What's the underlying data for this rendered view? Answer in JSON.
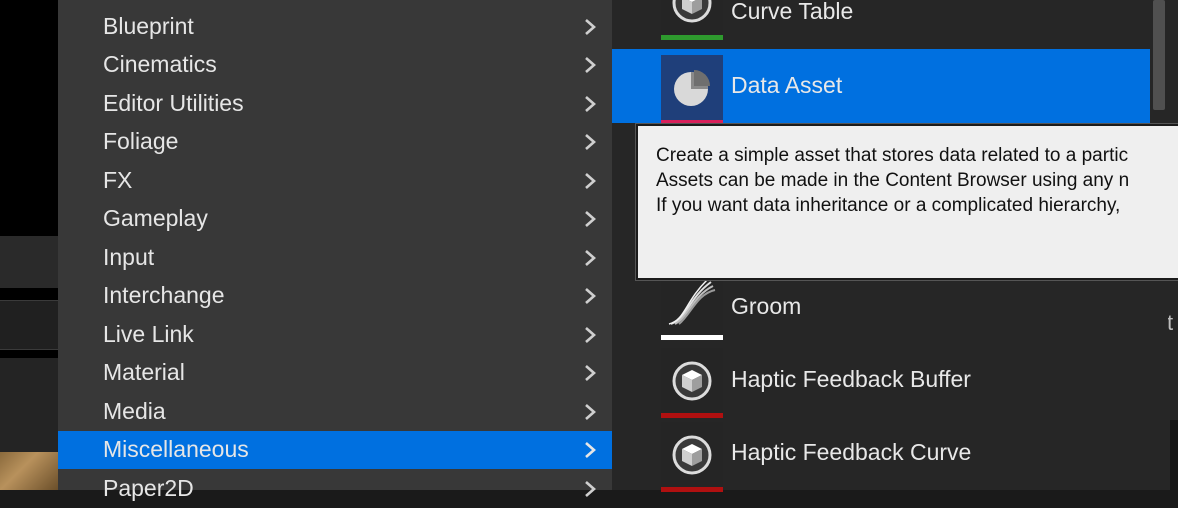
{
  "category_menu": {
    "items": [
      {
        "label": "Blueprint",
        "selected": false
      },
      {
        "label": "Cinematics",
        "selected": false
      },
      {
        "label": "Editor Utilities",
        "selected": false
      },
      {
        "label": "Foliage",
        "selected": false
      },
      {
        "label": "FX",
        "selected": false
      },
      {
        "label": "Gameplay",
        "selected": false
      },
      {
        "label": "Input",
        "selected": false
      },
      {
        "label": "Interchange",
        "selected": false
      },
      {
        "label": "Live Link",
        "selected": false
      },
      {
        "label": "Material",
        "selected": false
      },
      {
        "label": "Media",
        "selected": false
      },
      {
        "label": "Miscellaneous",
        "selected": true
      },
      {
        "label": "Paper2D",
        "selected": false
      }
    ],
    "arrow_icon": "chevron-right-icon"
  },
  "asset_list": {
    "items": [
      {
        "label": "Curve Table",
        "icon": "cube-icon",
        "color_bar": "#2e9a2e",
        "selected": false
      },
      {
        "label": "Data Asset",
        "icon": "pie-chart-icon",
        "color_bar": "#d8205a",
        "selected": true
      },
      {
        "label": "Groom",
        "icon": "hair-strands-icon",
        "color_bar": "#ffffff",
        "selected": false
      },
      {
        "label": "Haptic Feedback Buffer",
        "icon": "cube-icon",
        "color_bar": "#b01010",
        "selected": false
      },
      {
        "label": "Haptic Feedback Curve",
        "icon": "cube-icon",
        "color_bar": "#b01010",
        "selected": false
      }
    ]
  },
  "tooltip": {
    "lines": [
      "Create a simple asset that stores data related to a partic",
      "Assets can be made in the Content Browser using any n",
      "If you want data inheritance or a complicated hierarchy,"
    ]
  },
  "background": {
    "right_glyph": "t"
  },
  "colors": {
    "menu_bg": "#383838",
    "selection": "#0070e0",
    "tooltip_bg": "#efefef"
  }
}
